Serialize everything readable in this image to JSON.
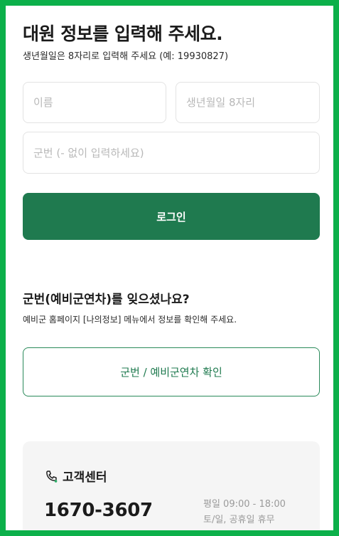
{
  "form": {
    "title": "대원 정보를 입력해 주세요.",
    "subtitle": "생년월일은 8자리로 입력해 주세요 (예: 19930827)",
    "name_placeholder": "이름",
    "birth_placeholder": "생년월일 8자리",
    "military_placeholder": "군번 (- 없이 입력하세요)",
    "login_label": "로그인"
  },
  "help": {
    "title": "군번(예비군연차)를 잊으셨나요?",
    "subtitle": "예비군 홈페이지 [나의정보] 메뉴에서 정보를 확인해 주세요.",
    "check_label": "군번 / 예비군연차 확인"
  },
  "support": {
    "icon": "phone-icon",
    "title": "고객센터",
    "phone": "1670-3607",
    "hours_weekday": "평일 09:00 - 18:00",
    "hours_weekend": "토/일, 공휴일 휴무"
  },
  "colors": {
    "border": "#0cb04a",
    "primary": "#1f7a4f",
    "card_bg": "#f5f5f5"
  }
}
